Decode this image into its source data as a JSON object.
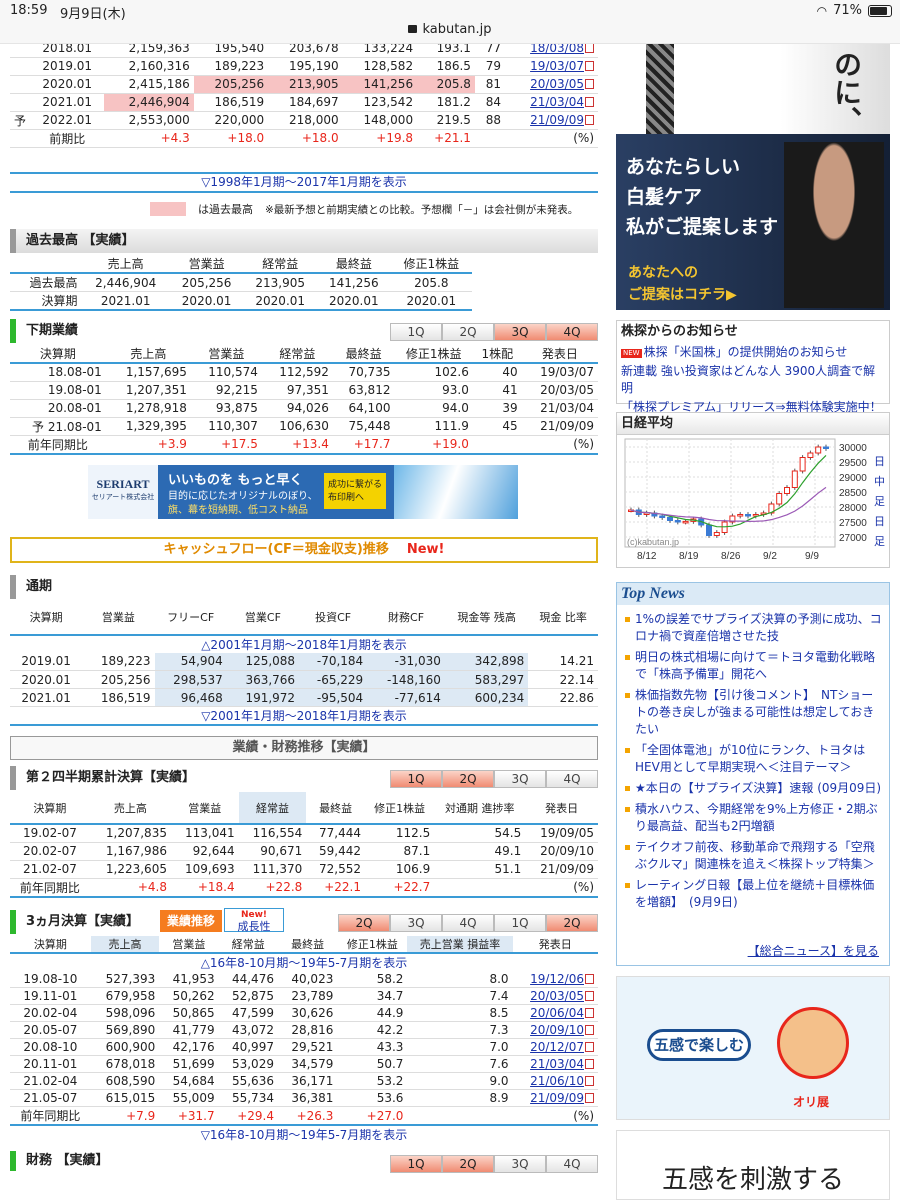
{
  "status": {
    "time": "18:59",
    "date": "9月9日(木)",
    "battery": "71%",
    "url": "kabutan.jp"
  },
  "topTable": {
    "rows": [
      {
        "pre": "",
        "period": "2018.01",
        "sales": "2,159,363",
        "op": "195,540",
        "ord": "203,678",
        "net": "133,224",
        "eps": "193.1",
        "div": "77",
        "date": "18/03/08",
        "hl": []
      },
      {
        "pre": "",
        "period": "2019.01",
        "sales": "2,160,316",
        "op": "189,223",
        "ord": "195,190",
        "net": "128,582",
        "eps": "186.5",
        "div": "79",
        "date": "19/03/07",
        "hl": []
      },
      {
        "pre": "",
        "period": "2020.01",
        "sales": "2,415,186",
        "op": "205,256",
        "ord": "213,905",
        "net": "141,256",
        "eps": "205.8",
        "div": "81",
        "date": "20/03/05",
        "hl": [
          "op",
          "ord",
          "net",
          "eps"
        ]
      },
      {
        "pre": "",
        "period": "2021.01",
        "sales": "2,446,904",
        "op": "186,519",
        "ord": "184,697",
        "net": "123,542",
        "eps": "181.2",
        "div": "84",
        "date": "21/03/04",
        "hl": [
          "sales"
        ]
      },
      {
        "pre": "予",
        "period": "2022.01",
        "sales": "2,553,000",
        "op": "220,000",
        "ord": "218,000",
        "net": "148,000",
        "eps": "219.5",
        "div": "88",
        "date": "21/09/09",
        "hl": []
      }
    ],
    "ratio": {
      "label": "前期比",
      "sales": "+4.3",
      "op": "+18.0",
      "ord": "+18.0",
      "net": "+19.8",
      "eps": "+21.1",
      "unit": "(%)"
    },
    "more": "▽1998年1月期～2017年1月期を表示",
    "legendLabel": "は過去最高",
    "legendNote": "※最新予想と前期実績との比較。予想欄「－」は会社側が未発表。"
  },
  "record": {
    "title": "過去最高 【実績】",
    "headers": [
      "",
      "売上高",
      "営業益",
      "経常益",
      "最終益",
      "修正1株益"
    ],
    "rows": [
      [
        "過去最高",
        "2,446,904",
        "205,256",
        "213,905",
        "141,256",
        "205.8"
      ],
      [
        "決算期",
        "2021.01",
        "2020.01",
        "2020.01",
        "2020.01",
        "2020.01"
      ]
    ]
  },
  "half": {
    "title": "下期業績",
    "tabs": [
      "1Q",
      "2Q",
      "3Q",
      "4Q"
    ],
    "headers": [
      "決算期",
      "売上高",
      "営業益",
      "経常益",
      "最終益",
      "修正1株益",
      "1株配",
      "発表日"
    ],
    "rows": [
      [
        "",
        "18.08-01",
        "1,157,695",
        "110,574",
        "112,592",
        "70,735",
        "102.6",
        "40",
        "19/03/07"
      ],
      [
        "",
        "19.08-01",
        "1,207,351",
        "92,215",
        "97,351",
        "63,812",
        "93.0",
        "41",
        "20/03/05"
      ],
      [
        "",
        "20.08-01",
        "1,278,918",
        "93,875",
        "94,026",
        "64,100",
        "94.0",
        "39",
        "21/03/04"
      ],
      [
        "予",
        "21.08-01",
        "1,329,395",
        "110,307",
        "106,630",
        "75,448",
        "111.9",
        "45",
        "21/09/09"
      ]
    ],
    "ratio": [
      "前年同期比",
      "+3.9",
      "+17.5",
      "+13.4",
      "+17.7",
      "+19.0",
      "",
      "(%)"
    ]
  },
  "banner": {
    "brand": "SERIART",
    "brand_sub": "セリアート株式会社",
    "line1": "いいものを もっと早く",
    "line2": "目的に応じたオリジナルのぼり、",
    "line3": "旗、幕を短納期、低コスト納品",
    "badge": "成功に繋がる 布印刷へ"
  },
  "cf": {
    "barTitle": "キャッシュフロー(CF＝現金収支)推移",
    "barNew": "New!",
    "title": "通期",
    "headers": [
      "決算期",
      "営業益",
      "フリーCF",
      "営業CF",
      "投資CF",
      "財務CF",
      "現金等 残高",
      "現金 比率"
    ],
    "moreTop": "△2001年1月期～2018年1月期を表示",
    "rows": [
      [
        "2019.01",
        "189,223",
        "54,904",
        "125,088",
        "-70,184",
        "-31,030",
        "342,898",
        "14.21"
      ],
      [
        "2020.01",
        "205,256",
        "298,537",
        "363,766",
        "-65,229",
        "-148,160",
        "583,297",
        "22.14"
      ],
      [
        "2021.01",
        "186,519",
        "96,468",
        "191,972",
        "-95,504",
        "-77,614",
        "600,234",
        "22.86"
      ]
    ],
    "moreBottom": "▽2001年1月期～2018年1月期を表示"
  },
  "trend": {
    "title": "業績・財務推移【実績】"
  },
  "q2": {
    "title": "第２四半期累計決算【実績】",
    "tabs": [
      "1Q",
      "2Q",
      "3Q",
      "4Q"
    ],
    "headers": [
      "決算期",
      "売上高",
      "営業益",
      "経常益",
      "最終益",
      "修正1株益",
      "対通期 進捗率",
      "発表日"
    ],
    "rows": [
      [
        "19.02-07",
        "1,207,835",
        "113,041",
        "116,554",
        "77,444",
        "112.5",
        "54.5",
        "19/09/05"
      ],
      [
        "20.02-07",
        "1,167,986",
        "92,644",
        "90,671",
        "59,442",
        "87.1",
        "49.1",
        "20/09/10"
      ],
      [
        "21.02-07",
        "1,223,605",
        "109,693",
        "111,370",
        "72,552",
        "106.9",
        "51.1",
        "21/09/09"
      ]
    ],
    "ratio": [
      "前年同期比",
      "+4.8",
      "+18.4",
      "+22.8",
      "+22.1",
      "+22.7",
      "",
      "(%)"
    ]
  },
  "q3m": {
    "title": "3ヵ月決算【実績】",
    "tab_trend": "業績推移",
    "tab_growth_new": "New!",
    "tab_growth": "成長性",
    "tabs": [
      "2Q",
      "3Q",
      "4Q",
      "1Q",
      "2Q"
    ],
    "headers": [
      "決算期",
      "売上高",
      "営業益",
      "経常益",
      "最終益",
      "修正1株益",
      "売上営業 損益率",
      "発表日"
    ],
    "moreTop": "△16年8-10月期～19年5-7月期を表示",
    "rows": [
      [
        "19.08-10",
        "527,393",
        "41,953",
        "44,476",
        "40,023",
        "58.2",
        "8.0",
        "19/12/06"
      ],
      [
        "19.11-01",
        "679,958",
        "50,262",
        "52,875",
        "23,789",
        "34.7",
        "7.4",
        "20/03/05"
      ],
      [
        "20.02-04",
        "598,096",
        "50,865",
        "47,599",
        "30,626",
        "44.9",
        "8.5",
        "20/06/04"
      ],
      [
        "20.05-07",
        "569,890",
        "41,779",
        "43,072",
        "28,816",
        "42.2",
        "7.3",
        "20/09/10"
      ],
      [
        "20.08-10",
        "600,900",
        "42,176",
        "40,997",
        "29,521",
        "43.3",
        "7.0",
        "20/12/07"
      ],
      [
        "20.11-01",
        "678,018",
        "51,699",
        "53,029",
        "34,579",
        "50.7",
        "7.6",
        "21/03/04"
      ],
      [
        "21.02-04",
        "608,590",
        "54,684",
        "55,636",
        "36,171",
        "53.2",
        "9.0",
        "21/06/10"
      ],
      [
        "21.05-07",
        "615,015",
        "55,009",
        "55,734",
        "36,381",
        "53.6",
        "8.9",
        "21/09/09"
      ]
    ],
    "ratio": [
      "前年同期比",
      "+7.9",
      "+31.7",
      "+29.4",
      "+26.3",
      "+27.0",
      "",
      "(%)"
    ],
    "moreBottom": "▽16年8-10月期～19年5-7月期を表示"
  },
  "finance": {
    "title": "財務 【実績】"
  },
  "sideAd1": {
    "line1": "あなたらしい",
    "line2": "白髪ケア",
    "line3": "私がご提案します",
    "cta1": "あなたへの",
    "cta2": "ご提案はコチラ▶",
    "top": "のに、"
  },
  "notice": {
    "title": "株探からのお知らせ",
    "items": [
      {
        "new": true,
        "text": "株探「米国株」の提供開始のお知らせ"
      },
      {
        "new": false,
        "text": "新連載 強い投資家はどんな人 3900人調査で解明"
      },
      {
        "new": false,
        "text": "「株探プレミアム」リリース⇒無料体験実施中！"
      }
    ]
  },
  "nikkei": {
    "title": "日経平均",
    "credit": "(c)kabutan.jp",
    "xlabels": [
      "8/12",
      "8/19",
      "8/26",
      "9/2",
      "9/9"
    ],
    "ylabels": [
      "30000",
      "29500",
      "29000",
      "28500",
      "28000",
      "27500",
      "27000"
    ],
    "side": [
      "日",
      "中",
      "足",
      "日",
      "足"
    ]
  },
  "topnews": {
    "title": "Top News",
    "items": [
      "1%の誤差でサプライズ決算の予測に成功、コロナ禍で資産倍増させた技",
      "明日の株式相場に向けて＝トヨタ電動化戦略で「株高予備軍」開花へ",
      "株価指数先物【引け後コメント】　NTショートの巻き戻しが強まる可能性は想定しておきたい",
      "「全固体電池」が10位にランク、トヨタはHEV用として早期実現へ＜注目テーマ＞",
      "★本日の【サプライズ決算】速報 (09月09日)",
      "積水ハウス、今期経常を9%上方修正・2期ぶり最高益、配当も2円増額",
      "テイクオフ前夜、移動革命で飛翔する「空飛ぶクルマ」関連株を追え＜株探トップ特集＞",
      "レーティング日報【最上位を継続＋目標株価を増額】　(9月9日)"
    ],
    "more": "【総合ニュース】を見る"
  },
  "sideAd2": {
    "bubble": "五感で楽しむ",
    "brand": "オリ展",
    "bottom": "五感を刺激する"
  },
  "colors": {
    "accent_blue": "#3a9bd6",
    "up_red": "#e8261b",
    "link": "#1a33aa",
    "highlight": "#f7c3c3"
  }
}
